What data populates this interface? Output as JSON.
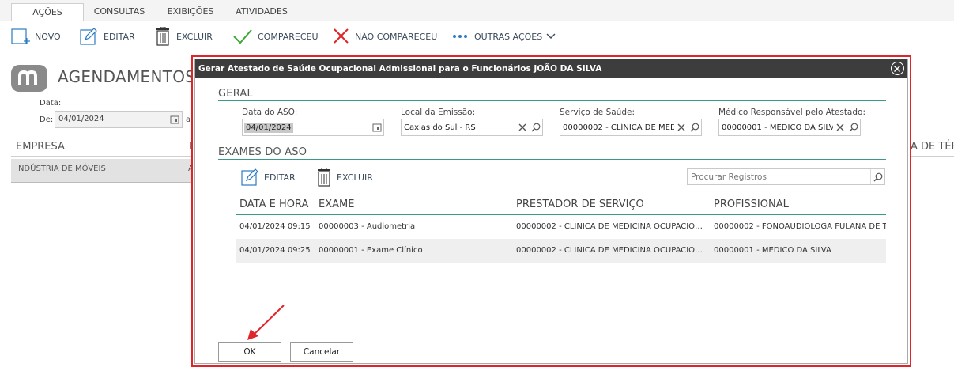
{
  "ribbon": {
    "tabs": [
      {
        "label": "AÇÕES",
        "active": true
      },
      {
        "label": "CONSULTAS",
        "active": false
      },
      {
        "label": "EXIBIÇÕES",
        "active": false
      },
      {
        "label": "ATIVIDADES",
        "active": false
      }
    ],
    "actions": {
      "novo": "NOVO",
      "editar": "EDITAR",
      "excluir": "EXCLUIR",
      "compareceu": "COMPARECEU",
      "nao_compareceu": "NÃO COMPARECEU",
      "outras_acoes": "OUTRAS AÇÕES"
    }
  },
  "background_page": {
    "title": "AGENDAMENTOS",
    "filter_label": "Data:",
    "from_label": "De:",
    "from_value": "04/01/2024",
    "to_label": "a",
    "columns": {
      "empresa": "EMPRESA",
      "col_i": "I",
      "right_partial": "A DE TÉR"
    },
    "rows": [
      {
        "empresa": "INDÚSTRIA DE MÓVEIS",
        "extra": "A"
      }
    ]
  },
  "modal": {
    "title": "Gerar Atestado de Saúde Ocupacional Admissional para o Funcionários JOÃO DA SILVA",
    "geral_title": "GERAL",
    "fields": {
      "data_aso_label": "Data do ASO:",
      "data_aso_value": "04/01/2024",
      "local_label": "Local da Emissão:",
      "local_value": "Caxias do Sul - RS",
      "servico_label": "Serviço de Saúde:",
      "servico_value": "00000002 - CLÍNICA DE MED",
      "medico_label": "Médico Responsável pelo Atestado:",
      "medico_value": "00000001 - MÉDICO DA SILV"
    },
    "exames_title": "EXAMES DO ASO",
    "editar_label": "EDITAR",
    "excluir_label": "EXCLUIR",
    "search_placeholder": "Procurar Registros",
    "table": {
      "headers": [
        "DATA E HORA",
        "EXAME",
        "PRESTADOR DE SERVIÇO",
        "PROFISSIONAL"
      ],
      "rows": [
        [
          "04/01/2024 09:15",
          "00000003 - Audiometria",
          "00000002 - CLÍNICA DE MEDICINA OCUPACIO…",
          "00000002 - FONOAUDIÓLOGA FULANA DE T"
        ],
        [
          "04/01/2024 09:25",
          "00000001 - Exame Clínico",
          "00000002 - CLÍNICA DE MEDICINA OCUPACIO…",
          "00000001 - MÉDICO DA SILVA"
        ]
      ]
    },
    "ok_label": "OK",
    "cancel_label": "Cancelar"
  },
  "colors": {
    "accent_teal": "#3a9a8a",
    "highlight_red": "#e0242a",
    "header_dark": "#3d3d3d",
    "action_blue": "#2b7bc0",
    "check_green": "#3aaa35"
  }
}
